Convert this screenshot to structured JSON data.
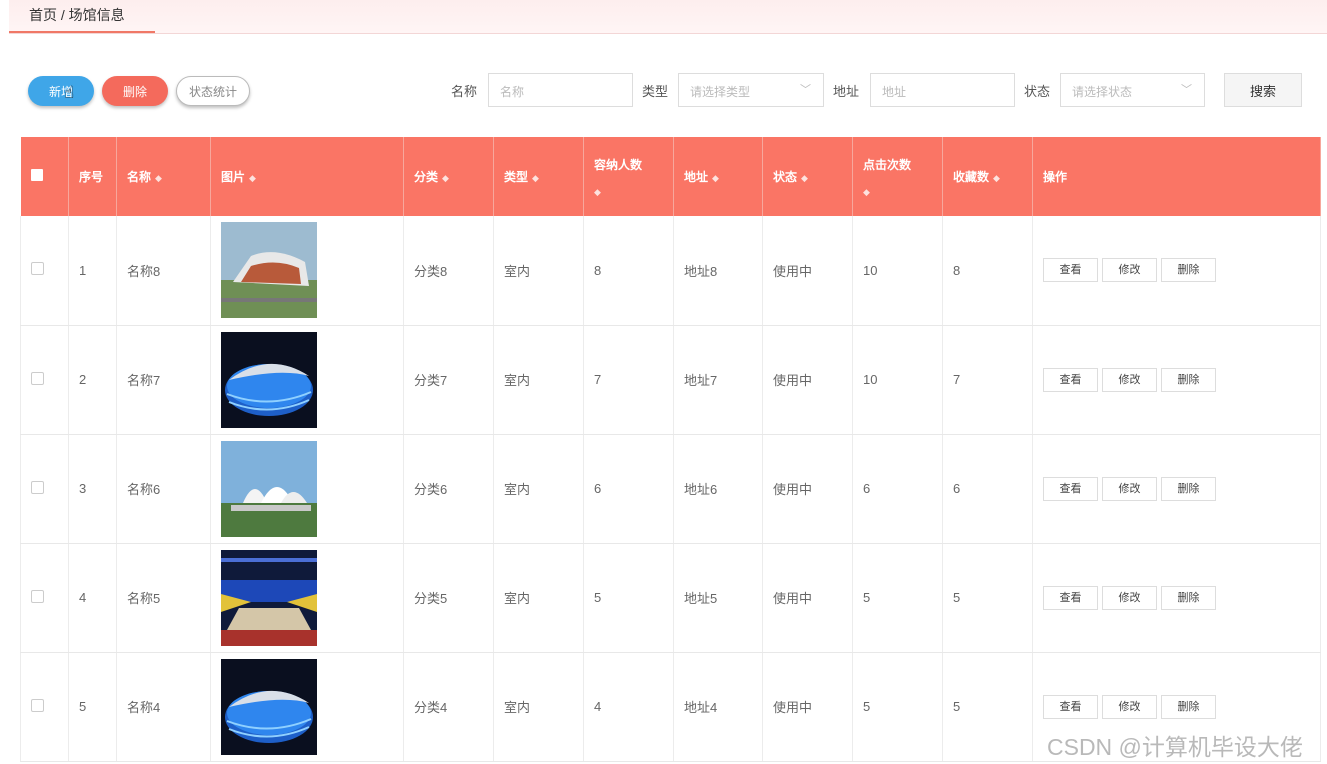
{
  "breadcrumb": "首页 / 场馆信息",
  "toolbar": {
    "add_label": "新增",
    "delete_label": "删除",
    "stats_label": "状态统计"
  },
  "filters": {
    "name_label": "名称",
    "name_placeholder": "名称",
    "type_label": "类型",
    "type_placeholder": "请选择类型",
    "address_label": "地址",
    "address_placeholder": "地址",
    "status_label": "状态",
    "status_placeholder": "请选择状态",
    "search_label": "搜索"
  },
  "table": {
    "headers": [
      "序号",
      "名称",
      "图片",
      "分类",
      "类型",
      "容纳人数",
      "地址",
      "状态",
      "点击次数",
      "收藏数",
      "操作"
    ],
    "actions": [
      "查看",
      "修改",
      "删除"
    ],
    "rows": [
      {
        "index": "1",
        "name": "名称8",
        "image": "stadium-aerial",
        "category": "分类8",
        "type": "室内",
        "capacity": "8",
        "address": "地址8",
        "status": "使用中",
        "clicks": "10",
        "favorites": "8"
      },
      {
        "index": "2",
        "name": "名称7",
        "image": "blue-lit-arena-night",
        "category": "分类7",
        "type": "室内",
        "capacity": "7",
        "address": "地址7",
        "status": "使用中",
        "clicks": "10",
        "favorites": "7"
      },
      {
        "index": "3",
        "name": "名称6",
        "image": "white-roof-stadium",
        "category": "分类6",
        "type": "室内",
        "capacity": "6",
        "address": "地址6",
        "status": "使用中",
        "clicks": "6",
        "favorites": "6"
      },
      {
        "index": "4",
        "name": "名称5",
        "image": "indoor-arena-seats",
        "category": "分类5",
        "type": "室内",
        "capacity": "5",
        "address": "地址5",
        "status": "使用中",
        "clicks": "5",
        "favorites": "5"
      },
      {
        "index": "5",
        "name": "名称4",
        "image": "blue-lit-arena-night",
        "category": "分类4",
        "type": "室内",
        "capacity": "4",
        "address": "地址4",
        "status": "使用中",
        "clicks": "5",
        "favorites": "5"
      }
    ]
  },
  "watermark": "CSDN @计算机毕设大佬",
  "colors": {
    "header_bg": "#fa7565",
    "add_button": "#3fa6e8",
    "delete_button": "#f46a5c"
  }
}
